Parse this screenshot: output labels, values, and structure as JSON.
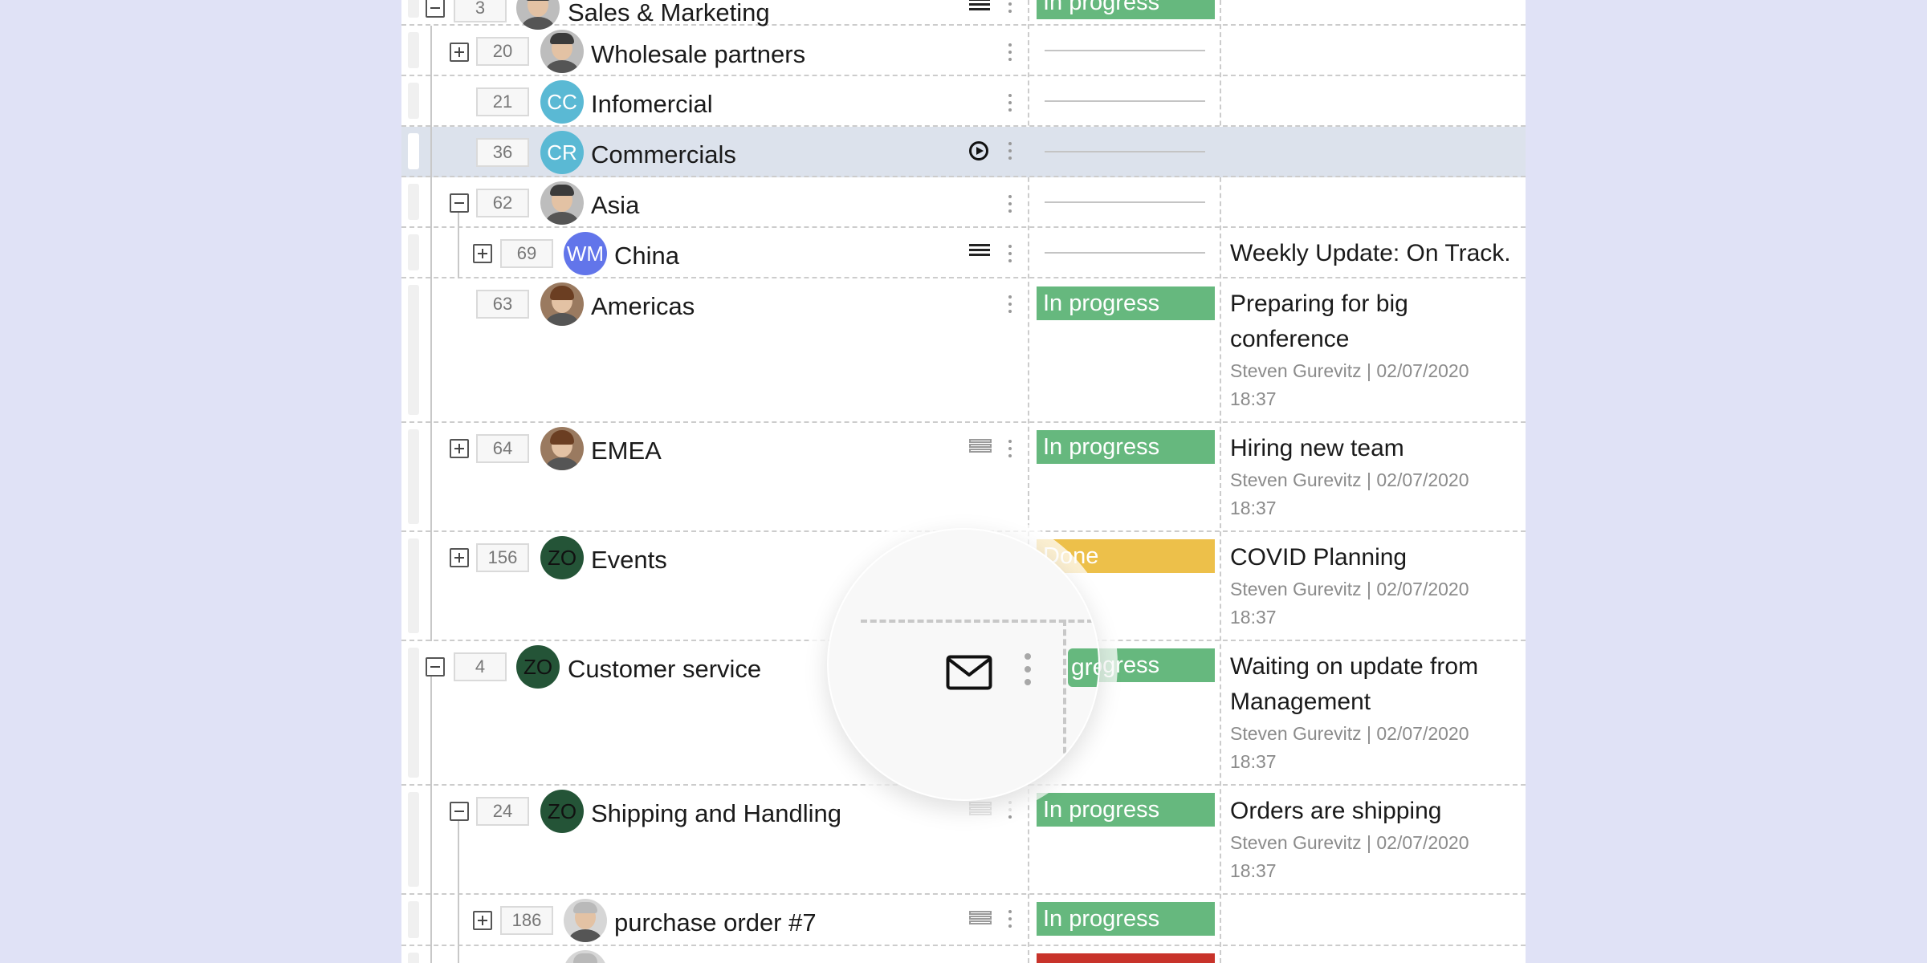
{
  "colors": {
    "background": "#e0e2f6",
    "in_progress": "#66b87e",
    "done": "#edc04a",
    "stuck": "#c8332a",
    "avatar_cyan": "#5ab9d4",
    "avatar_indigo": "#6275ea",
    "avatar_dark_green": "#245437"
  },
  "rows": [
    {
      "id": "3",
      "name": "Sales & Marketing",
      "avatar": "photo-man",
      "expander": "minus",
      "icon": "lines-icon",
      "status": "In progress"
    },
    {
      "id": "20",
      "name": "Wholesale partners",
      "avatar": "photo-man",
      "expander": "plus",
      "status": ""
    },
    {
      "id": "21",
      "name": "Infomercial",
      "avatar": "CC",
      "status": ""
    },
    {
      "id": "36",
      "name": "Commercials",
      "avatar": "CR",
      "icon": "play-icon",
      "status": "",
      "selected": true
    },
    {
      "id": "62",
      "name": "Asia",
      "avatar": "photo-man",
      "expander": "minus",
      "status": ""
    },
    {
      "id": "69",
      "name": "China",
      "avatar": "WM",
      "expander": "plus",
      "icon": "lines-icon",
      "status": "",
      "update": "Weekly Update: On Track."
    },
    {
      "id": "63",
      "name": "Americas",
      "avatar": "photo-woman",
      "status": "In progress",
      "update": "Preparing for big conference",
      "meta": "Steven Gurevitz | 02/07/2020 18:37"
    },
    {
      "id": "64",
      "name": "EMEA",
      "avatar": "photo-woman",
      "expander": "plus",
      "icon": "stack-icon",
      "status": "In progress",
      "update": "Hiring new team",
      "meta": "Steven Gurevitz | 02/07/2020 18:37"
    },
    {
      "id": "156",
      "name": "Events",
      "avatar": "ZO",
      "expander": "plus",
      "status": "Done",
      "update": "COVID Planning",
      "meta": "Steven Gurevitz | 02/07/2020 18:37"
    },
    {
      "id": "4",
      "name": "Customer service",
      "avatar": "ZO",
      "expander": "minus",
      "status": "In progress",
      "update": "Waiting on update from Management",
      "meta": "Steven Gurevitz | 02/07/2020 18:37"
    },
    {
      "id": "24",
      "name": "Shipping and Handling",
      "avatar": "ZO",
      "expander": "minus",
      "icon": "stack-icon",
      "status": "In progress",
      "update": "Orders are shipping",
      "meta": "Steven Gurevitz | 02/07/2020 18:37"
    },
    {
      "id": "186",
      "name": "purchase order #7",
      "avatar": "photo-man",
      "expander": "plus",
      "icon": "stack-icon",
      "status": "In progress"
    }
  ],
  "zoom": {
    "icon": "envelope-icon",
    "visible_status_fragment": "gress"
  }
}
